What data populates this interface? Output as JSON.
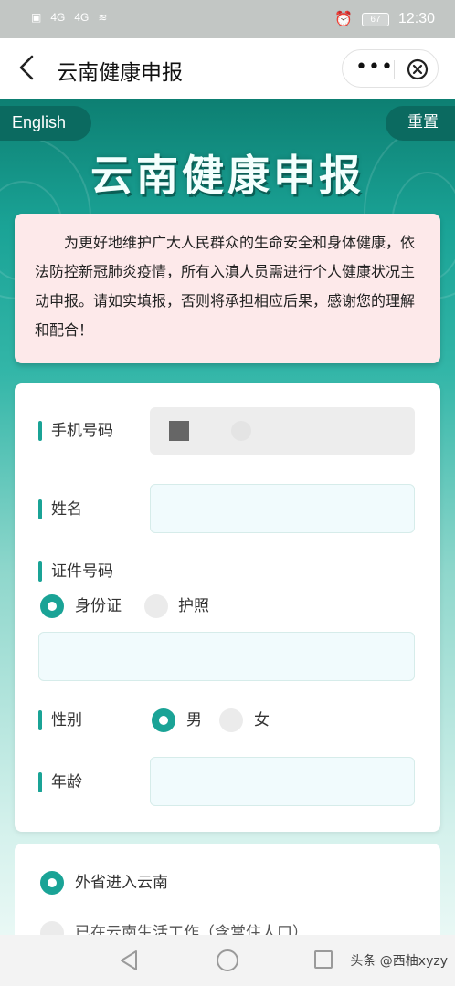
{
  "status_bar": {
    "left_icons": [
      "sim-icon",
      "4G",
      "4G",
      "wifi-icon"
    ],
    "alarm_icon": "alarm-icon",
    "battery": "67",
    "time": "12:30"
  },
  "title_bar": {
    "title": "云南健康申报",
    "more_label": "•••",
    "back_icon": "chevron-left-icon",
    "close_icon": "close-circle-icon"
  },
  "banner": {
    "language_button": "English",
    "reset_button": "重置",
    "heading": "云南健康申报"
  },
  "notice": {
    "text": "为更好地维护广大人民群众的生命安全和身体健康，依法防控新冠肺炎疫情，所有入滇人员需进行个人健康状况主动申报。请如实填报，否则将承担相应后果，感谢您的理解和配合！"
  },
  "form": {
    "phone_label": "手机号码",
    "name_label": "姓名",
    "id_label": "证件号码",
    "id_options": [
      {
        "label": "身份证",
        "selected": true
      },
      {
        "label": "护照",
        "selected": false
      }
    ],
    "gender_label": "性别",
    "gender_options": [
      {
        "label": "男",
        "selected": true
      },
      {
        "label": "女",
        "selected": false
      }
    ],
    "age_label": "年龄"
  },
  "entry_type": {
    "options": [
      {
        "label": "外省进入云南",
        "selected": true
      },
      {
        "label": "已在云南生活工作（含常住人口）",
        "selected": false
      }
    ]
  },
  "nav_bar": {
    "watermark": "头条 @西柚xyzy"
  },
  "colors": {
    "accent": "#1aa396",
    "dark_teal": "#0b6a60",
    "notice_bg": "#fde9ea"
  }
}
